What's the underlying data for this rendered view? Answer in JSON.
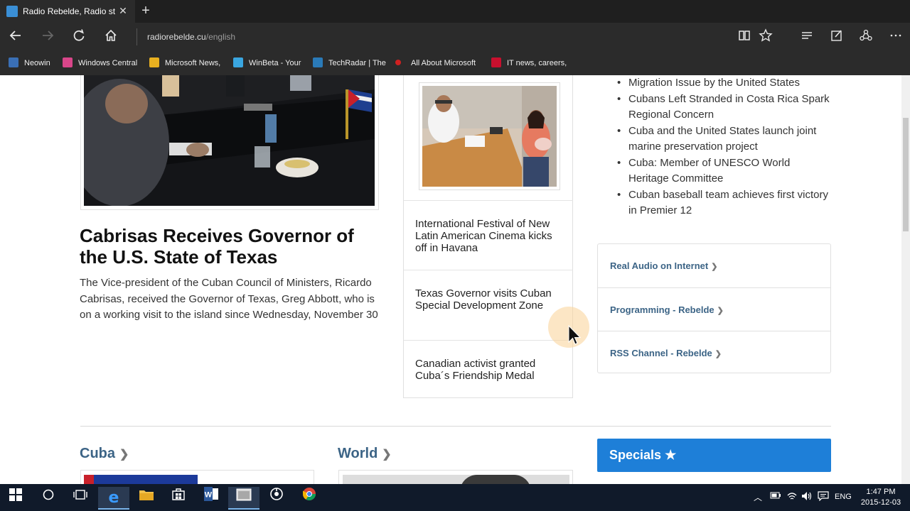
{
  "browser": {
    "tab_title": "Radio Rebelde, Radio st",
    "tab_close": "✕",
    "new_tab": "+",
    "url_host": "radiorebelde.cu",
    "url_path": "/english",
    "favorites": [
      {
        "label": "Neowin",
        "color": "#3a6fb5"
      },
      {
        "label": "Windows Central",
        "color": "#d9468a"
      },
      {
        "label": "Microsoft News,",
        "color": "#e8b020"
      },
      {
        "label": "WinBeta - Your",
        "color": "#3aa6e0"
      },
      {
        "label": "TechRadar | The",
        "color": "#2a7ab8"
      },
      {
        "label": "All About Microsoft",
        "color": "#d02020"
      },
      {
        "label": "IT news, careers,",
        "color": "#c8102e"
      }
    ]
  },
  "main_story": {
    "headline": "Cabrisas Receives Governor of the U.S. State of Texas",
    "summary": "The Vice-president of the Cuban Council of Ministers, Ricardo Cabrisas, received the Governor of Texas, Greg Abbott, who is on a working visit to the island since Wednesday, November 30"
  },
  "side_stories": [
    {
      "title": "International Festival of New Latin American Cinema kicks off in Havana"
    },
    {
      "title": "Texas Governor visits Cuban Special Development Zone"
    },
    {
      "title": "Canadian activist granted Cuba´s Friendship Medal"
    }
  ],
  "headlines_list": [
    "Migration Issue by the United States",
    "Cubans Left Stranded in Costa Rica Spark Regional Concern",
    "Cuba and the United States launch joint marine preservation project",
    "Cuba: Member of UNESCO World Heritage Committee",
    "Cuban baseball team achieves first victory in Premier 12"
  ],
  "links": [
    {
      "label": "Real Audio on Internet"
    },
    {
      "label": "Programming - Rebelde"
    },
    {
      "label": "RSS Channel - Rebelde"
    }
  ],
  "sections": {
    "cuba": "Cuba",
    "world": "World",
    "specials": "Specials"
  },
  "taskbar": {
    "language": "ENG",
    "time": "1:47 PM",
    "date": "2015-12-03"
  }
}
